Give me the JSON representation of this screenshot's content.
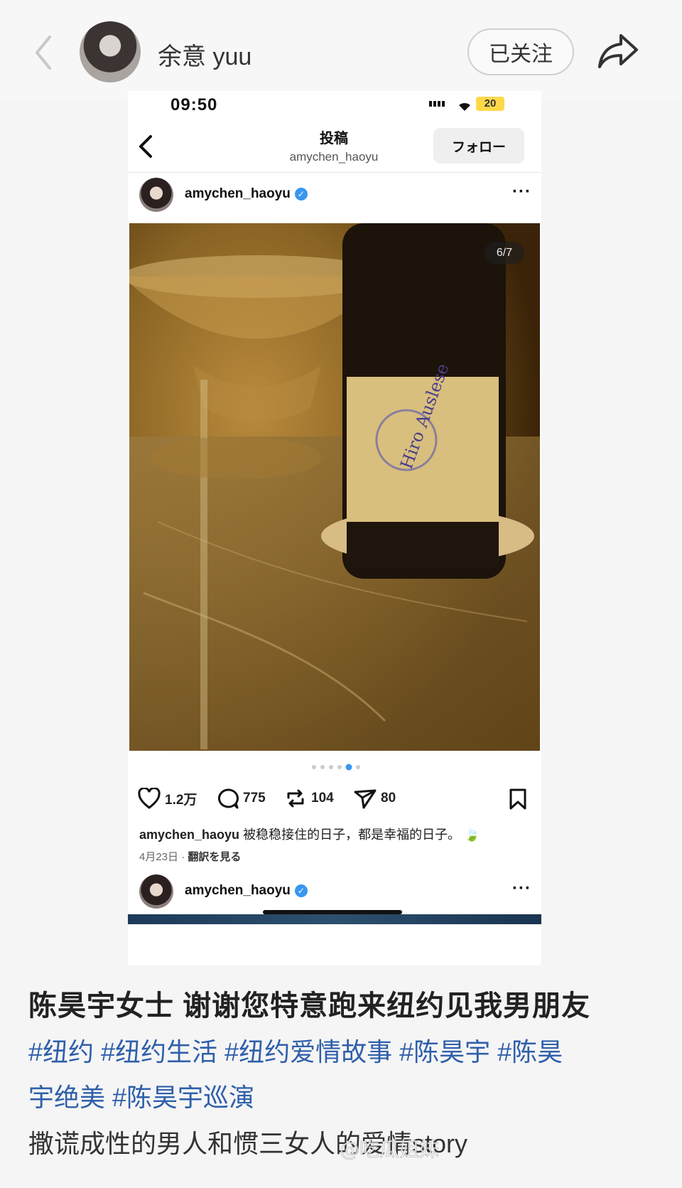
{
  "header": {
    "username": "余意 yuu",
    "follow_label": "已关注"
  },
  "shot": {
    "status_time": "09:50",
    "battery": "20",
    "nav_title": "投稿",
    "nav_subtitle": "amychen_haoyu",
    "nav_follow": "フォロー",
    "post_user": "amychen_haoyu",
    "photo_counter": "6/7",
    "likes": "1.2万",
    "comments": "775",
    "reposts": "104",
    "shares": "80",
    "caption_user": "amychen_haoyu",
    "caption_text": "被稳稳接住的日子，都是幸福的日子。",
    "date": "4月23日",
    "translate": "翻訳を見る",
    "next_user": "amychen_haoyu",
    "bottle_text": "Hiro Auslese"
  },
  "note": {
    "title": "陈昊宇女士 谢谢您特意跑来纽约见我男朋友",
    "tags_line1": "#纽约 #纽约生活 #纽约爱情故事 #陈昊宇 #陈昊",
    "tags_line2": "宇绝美 #陈昊宇巡演",
    "body": "撒谎成性的男人和惯三女人的爱情story",
    "watermark": "@吃瓜姐妹"
  },
  "colors": {
    "hashtag": "#2f5faa",
    "verified": "#3897f0",
    "battery": "#ffd84a"
  }
}
